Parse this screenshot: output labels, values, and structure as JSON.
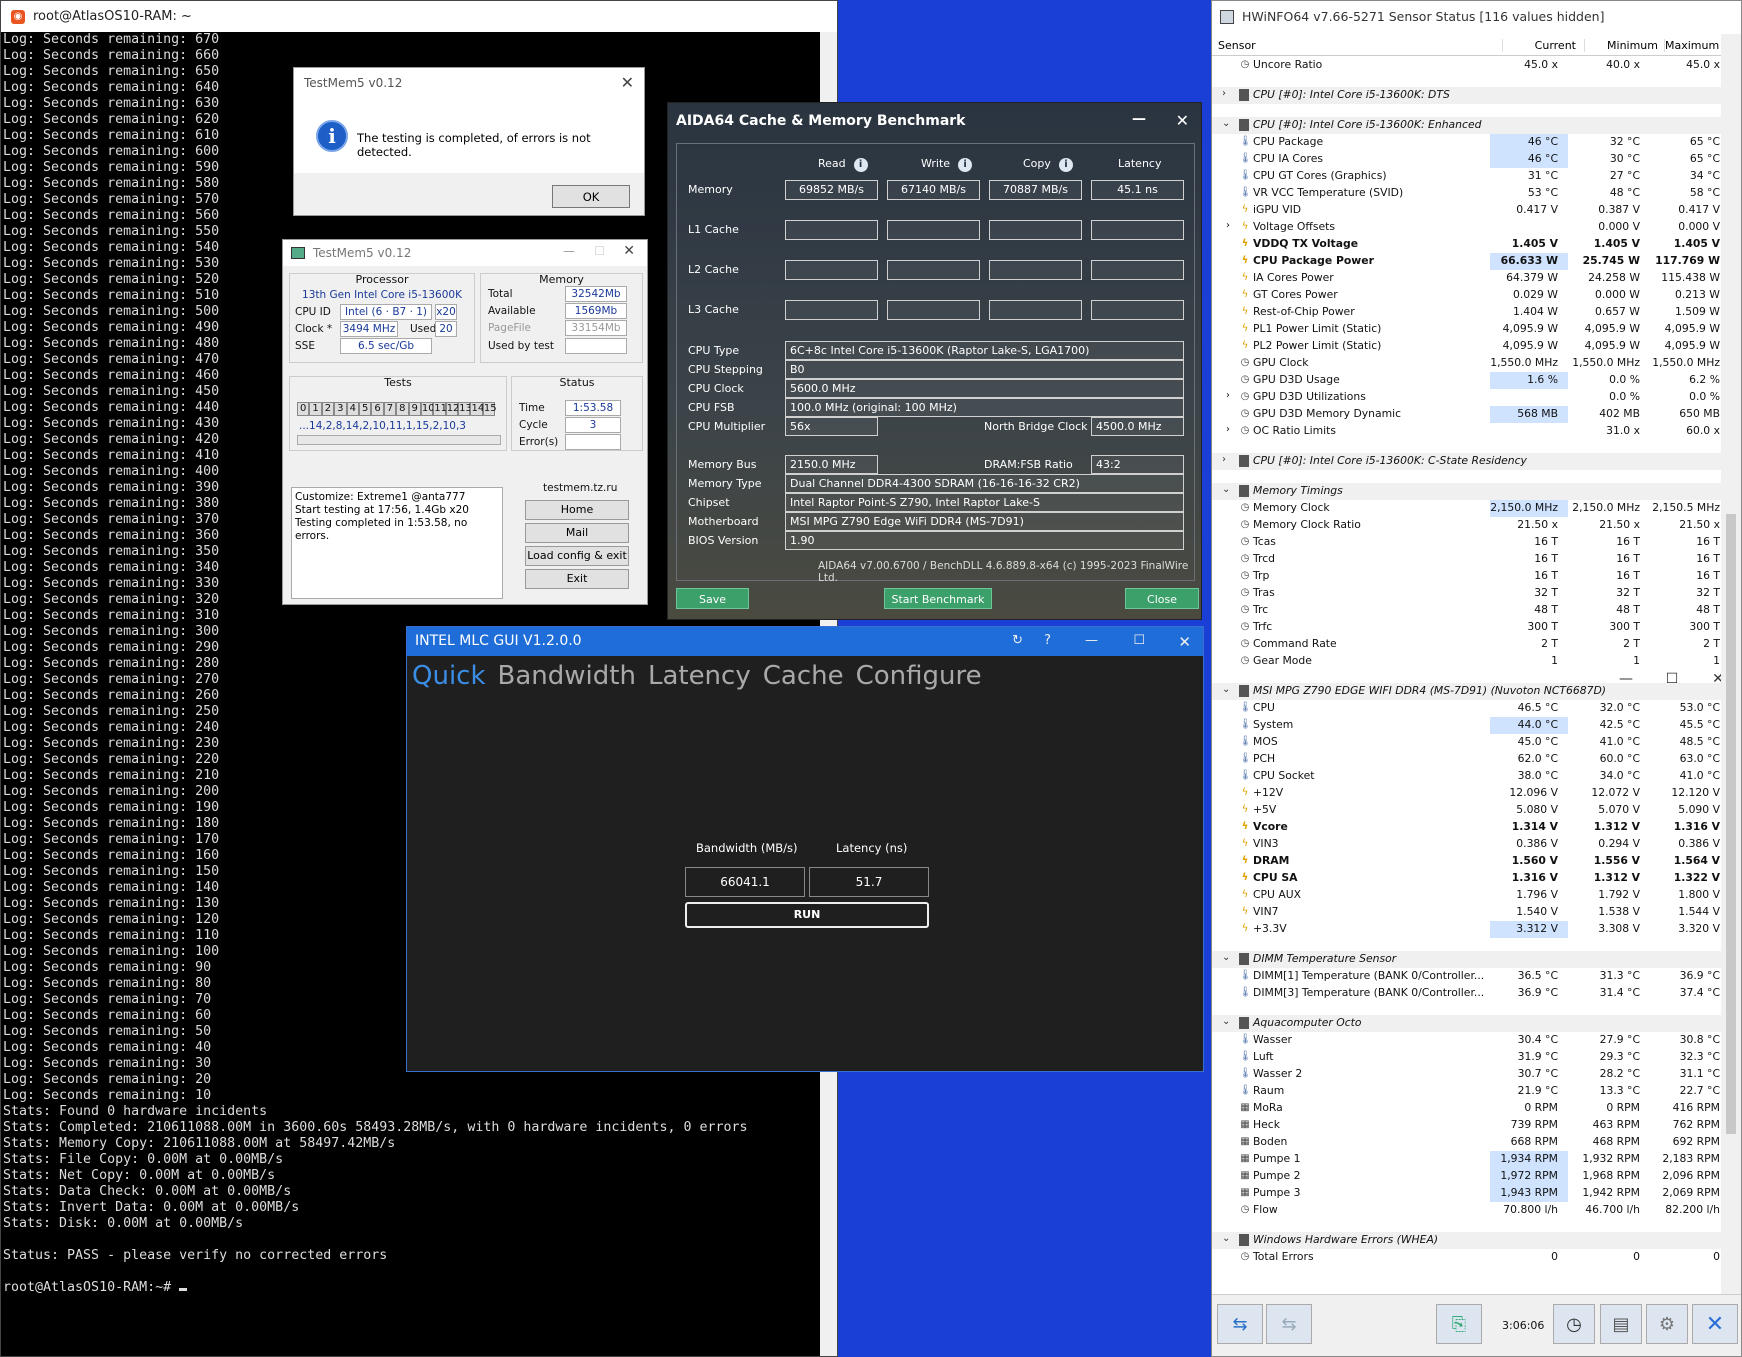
{
  "terminal": {
    "title": "root@AtlasOS10-RAM: ~",
    "log_lines": [
      "Log: Seconds remaining: 670",
      "Log: Seconds remaining: 660",
      "Log: Seconds remaining: 650",
      "Log: Seconds remaining: 640",
      "Log: Seconds remaining: 630",
      "Log: Seconds remaining: 620",
      "Log: Seconds remaining: 610",
      "Log: Seconds remaining: 600",
      "Log: Seconds remaining: 590",
      "Log: Seconds remaining: 580",
      "Log: Seconds remaining: 570",
      "Log: Seconds remaining: 560",
      "Log: Seconds remaining: 550",
      "Log: Seconds remaining: 540",
      "Log: Seconds remaining: 530",
      "Log: Seconds remaining: 520",
      "Log: Seconds remaining: 510",
      "Log: Seconds remaining: 500",
      "Log: Seconds remaining: 490",
      "Log: Seconds remaining: 480",
      "Log: Seconds remaining: 470",
      "Log: Seconds remaining: 460",
      "Log: Seconds remaining: 450",
      "Log: Seconds remaining: 440",
      "Log: Seconds remaining: 430",
      "Log: Seconds remaining: 420",
      "Log: Seconds remaining: 410",
      "Log: Seconds remaining: 400",
      "Log: Seconds remaining: 390",
      "Log: Seconds remaining: 380",
      "Log: Seconds remaining: 370",
      "Log: Seconds remaining: 360",
      "Log: Seconds remaining: 350",
      "Log: Seconds remaining: 340",
      "Log: Seconds remaining: 330",
      "Log: Seconds remaining: 320",
      "Log: Seconds remaining: 310",
      "Log: Seconds remaining: 300",
      "Log: Seconds remaining: 290",
      "Log: Seconds remaining: 280",
      "Log: Seconds remaining: 270",
      "Log: Seconds remaining: 260",
      "Log: Seconds remaining: 250",
      "Log: Seconds remaining: 240",
      "Log: Seconds remaining: 230",
      "Log: Seconds remaining: 220",
      "Log: Seconds remaining: 210",
      "Log: Seconds remaining: 200",
      "Log: Seconds remaining: 190",
      "Log: Seconds remaining: 180",
      "Log: Seconds remaining: 170",
      "Log: Seconds remaining: 160",
      "Log: Seconds remaining: 150",
      "Log: Seconds remaining: 140",
      "Log: Seconds remaining: 130",
      "Log: Seconds remaining: 120",
      "Log: Seconds remaining: 110",
      "Log: Seconds remaining: 100",
      "Log: Seconds remaining: 90",
      "Log: Seconds remaining: 80",
      "Log: Seconds remaining: 70",
      "Log: Seconds remaining: 60",
      "Log: Seconds remaining: 50",
      "Log: Seconds remaining: 40",
      "Log: Seconds remaining: 30",
      "Log: Seconds remaining: 20",
      "Log: Seconds remaining: 10",
      "Stats: Found 0 hardware incidents",
      "Stats: Completed: 210611088.00M in 3600.60s 58493.28MB/s, with 0 hardware incidents, 0 errors",
      "Stats: Memory Copy: 210611088.00M at 58497.42MB/s",
      "Stats: File Copy: 0.00M at 0.00MB/s",
      "Stats: Net Copy: 0.00M at 0.00MB/s",
      "Stats: Data Check: 0.00M at 0.00MB/s",
      "Stats: Invert Data: 0.00M at 0.00MB/s",
      "Stats: Disk: 0.00M at 0.00MB/s",
      "",
      "Status: PASS - please verify no corrected errors",
      ""
    ],
    "prompt": "root@AtlasOS10-RAM:~# "
  },
  "tm_dialog": {
    "title": "TestMem5 v0.12",
    "message": "The testing is completed, of errors is not detected.",
    "ok": "OK"
  },
  "testmem": {
    "title": "TestMem5 v0.12",
    "processor_label": "Processor",
    "processor_name": "13th Gen Intel Core i5-13600K",
    "cpuid_label": "CPU ID",
    "cpuid": "Intel (6 · B7 · 1)",
    "threads": "x20",
    "clock_label": "Clock *",
    "clock": "3494 MHz",
    "used_label": "Used",
    "used": "20",
    "sse_label": "SSE",
    "sse": "6.5 sec/Gb",
    "memory_label": "Memory",
    "total_label": "Total",
    "total": "32542Mb",
    "available_label": "Available",
    "available": "1569Mb",
    "pagefile_label": "PageFile",
    "pagefile": "33154Mb",
    "usedbytest_label": "Used by test",
    "usedbytest": "",
    "tests_label": "Tests",
    "test_cells": [
      "0",
      "1",
      "2",
      "3",
      "4",
      "5",
      "6",
      "7",
      "8",
      "9",
      "10",
      "11",
      "12",
      "13",
      "14",
      "15"
    ],
    "test_sequence": "...14,2,8,14,2,10,11,1,15,2,10,3",
    "status_label": "Status",
    "time_label": "Time",
    "time": "1:53.58",
    "cycle_label": "Cycle",
    "cycle": "3",
    "errors_label": "Error(s)",
    "errors": "",
    "log": [
      "Customize: Extreme1 @anta777",
      "Start testing at 17:56, 1.4Gb x20",
      "Testing completed in 1:53.58, no errors."
    ],
    "site": "testmem.tz.ru",
    "btn_home": "Home",
    "btn_mail": "Mail",
    "btn_load": "Load config & exit",
    "btn_exit": "Exit"
  },
  "aida": {
    "title": "AIDA64 Cache & Memory Benchmark",
    "col_read": "Read",
    "col_write": "Write",
    "col_copy": "Copy",
    "col_latency": "Latency",
    "row_memory": "Memory",
    "row_l1": "L1 Cache",
    "row_l2": "L2 Cache",
    "row_l3": "L3 Cache",
    "mem_read": "69852 MB/s",
    "mem_write": "67140 MB/s",
    "mem_copy": "70887 MB/s",
    "mem_latency": "45.1 ns",
    "cpu_type_label": "CPU Type",
    "cpu_type": "6C+8c Intel Core i5-13600K (Raptor Lake-S, LGA1700)",
    "cpu_stepping_label": "CPU Stepping",
    "cpu_stepping": "B0",
    "cpu_clock_label": "CPU Clock",
    "cpu_clock": "5600.0 MHz",
    "cpu_fsb_label": "CPU FSB",
    "cpu_fsb": "100.0 MHz (original: 100 MHz)",
    "cpu_mult_label": "CPU Multiplier",
    "cpu_mult": "56x",
    "nb_clock_label": "North Bridge Clock",
    "nb_clock": "4500.0 MHz",
    "mem_bus_label": "Memory Bus",
    "mem_bus": "2150.0 MHz",
    "dram_fsb_label": "DRAM:FSB Ratio",
    "dram_fsb": "43:2",
    "mem_type_label": "Memory Type",
    "mem_type": "Dual Channel DDR4-4300 SDRAM (16-16-16-32 CR2)",
    "chipset_label": "Chipset",
    "chipset": "Intel Raptor Point-S Z790, Intel Raptor Lake-S",
    "mobo_label": "Motherboard",
    "mobo": "MSI MPG Z790 Edge WiFi DDR4 (MS-7D91)",
    "bios_label": "BIOS Version",
    "bios": "1.90",
    "footer": "AIDA64 v7.00.6700 / BenchDLL 4.6.889.8-x64 (c) 1995-2023 FinalWire Ltd.",
    "btn_save": "Save",
    "btn_start": "Start Benchmark",
    "btn_close": "Close"
  },
  "mlc": {
    "title": "INTEL MLC GUI V1.2.0.0",
    "tabs": [
      "Quick",
      "Bandwidth",
      "Latency",
      "Cache",
      "Configure"
    ],
    "bw_label": "Bandwidth (MB/s)",
    "lat_label": "Latency (ns)",
    "bw_value": "66041.1",
    "lat_value": "51.7",
    "run": "RUN"
  },
  "hwinfo": {
    "title": "HWiNFO64 v7.66-5271 Sensor Status [116 values hidden]",
    "col_sensor": "Sensor",
    "col_current": "Current",
    "col_min": "Minimum",
    "col_max": "Maximum",
    "time": "3:06:06",
    "rows": [
      {
        "t": "r",
        "icon": "o",
        "n": "Uncore Ratio",
        "c": "45.0 x",
        "mi": "40.0 x",
        "ma": "45.0 x"
      },
      {
        "t": "s"
      },
      {
        "t": "g",
        "exp": ">",
        "n": "CPU [#0]: Intel Core i5-13600K: DTS"
      },
      {
        "t": "s"
      },
      {
        "t": "g",
        "exp": "v",
        "n": "CPU [#0]: Intel Core i5-13600K: Enhanced"
      },
      {
        "t": "r",
        "icon": "t",
        "n": "CPU Package",
        "c": "46 °C",
        "mi": "32 °C",
        "ma": "65 °C",
        "hl": true
      },
      {
        "t": "r",
        "icon": "t",
        "n": "CPU IA Cores",
        "c": "46 °C",
        "mi": "30 °C",
        "ma": "65 °C",
        "hl": true
      },
      {
        "t": "r",
        "icon": "t",
        "n": "CPU GT Cores (Graphics)",
        "c": "31 °C",
        "mi": "27 °C",
        "ma": "34 °C"
      },
      {
        "t": "r",
        "icon": "t",
        "n": "VR VCC Temperature (SVID)",
        "c": "53 °C",
        "mi": "48 °C",
        "ma": "58 °C"
      },
      {
        "t": "r",
        "icon": "v",
        "n": "iGPU VID",
        "c": "0.417 V",
        "mi": "0.387 V",
        "ma": "0.417 V"
      },
      {
        "t": "r",
        "icon": "v",
        "exp": ">",
        "n": "Voltage Offsets",
        "c": "",
        "mi": "0.000 V",
        "ma": "0.000 V"
      },
      {
        "t": "r",
        "icon": "v",
        "n": "VDDQ TX Voltage",
        "c": "1.405 V",
        "mi": "1.405 V",
        "ma": "1.405 V",
        "b": true
      },
      {
        "t": "r",
        "icon": "v",
        "n": "CPU Package Power",
        "c": "66.633 W",
        "mi": "25.745 W",
        "ma": "117.769 W",
        "b": true,
        "hl": true
      },
      {
        "t": "r",
        "icon": "v",
        "n": "IA Cores Power",
        "c": "64.379 W",
        "mi": "24.258 W",
        "ma": "115.438 W"
      },
      {
        "t": "r",
        "icon": "v",
        "n": "GT Cores Power",
        "c": "0.029 W",
        "mi": "0.000 W",
        "ma": "0.213 W"
      },
      {
        "t": "r",
        "icon": "v",
        "n": "Rest-of-Chip Power",
        "c": "1.404 W",
        "mi": "0.657 W",
        "ma": "1.509 W"
      },
      {
        "t": "r",
        "icon": "v",
        "n": "PL1 Power Limit (Static)",
        "c": "4,095.9 W",
        "mi": "4,095.9 W",
        "ma": "4,095.9 W"
      },
      {
        "t": "r",
        "icon": "v",
        "n": "PL2 Power Limit (Static)",
        "c": "4,095.9 W",
        "mi": "4,095.9 W",
        "ma": "4,095.9 W"
      },
      {
        "t": "r",
        "icon": "o",
        "n": "GPU Clock",
        "c": "1,550.0 MHz",
        "mi": "1,550.0 MHz",
        "ma": "1,550.0 MHz"
      },
      {
        "t": "r",
        "icon": "o",
        "n": "GPU D3D Usage",
        "c": "1.6 %",
        "mi": "0.0 %",
        "ma": "6.2 %",
        "hl": true
      },
      {
        "t": "r",
        "icon": "o",
        "exp": ">",
        "n": "GPU D3D Utilizations",
        "c": "",
        "mi": "0.0 %",
        "ma": "0.0 %"
      },
      {
        "t": "r",
        "icon": "o",
        "n": "GPU D3D Memory Dynamic",
        "c": "568 MB",
        "mi": "402 MB",
        "ma": "650 MB",
        "hl": true
      },
      {
        "t": "r",
        "icon": "o",
        "exp": ">",
        "n": "OC Ratio Limits",
        "c": "",
        "mi": "31.0 x",
        "ma": "60.0 x"
      },
      {
        "t": "s"
      },
      {
        "t": "g",
        "exp": ">",
        "n": "CPU [#0]: Intel Core i5-13600K: C-State Residency"
      },
      {
        "t": "s"
      },
      {
        "t": "g",
        "exp": "v",
        "n": "Memory Timings"
      },
      {
        "t": "r",
        "icon": "o",
        "n": "Memory Clock",
        "c": "2,150.0 MHz",
        "mi": "2,150.0 MHz",
        "ma": "2,150.5 MHz",
        "hl": true
      },
      {
        "t": "r",
        "icon": "o",
        "n": "Memory Clock Ratio",
        "c": "21.50 x",
        "mi": "21.50 x",
        "ma": "21.50 x"
      },
      {
        "t": "r",
        "icon": "o",
        "n": "Tcas",
        "c": "16 T",
        "mi": "16 T",
        "ma": "16 T"
      },
      {
        "t": "r",
        "icon": "o",
        "n": "Trcd",
        "c": "16 T",
        "mi": "16 T",
        "ma": "16 T"
      },
      {
        "t": "r",
        "icon": "o",
        "n": "Trp",
        "c": "16 T",
        "mi": "16 T",
        "ma": "16 T"
      },
      {
        "t": "r",
        "icon": "o",
        "n": "Tras",
        "c": "32 T",
        "mi": "32 T",
        "ma": "32 T"
      },
      {
        "t": "r",
        "icon": "o",
        "n": "Trc",
        "c": "48 T",
        "mi": "48 T",
        "ma": "48 T"
      },
      {
        "t": "r",
        "icon": "o",
        "n": "Trfc",
        "c": "300 T",
        "mi": "300 T",
        "ma": "300 T"
      },
      {
        "t": "r",
        "icon": "o",
        "n": "Command Rate",
        "c": "2 T",
        "mi": "2 T",
        "ma": "2 T"
      },
      {
        "t": "r",
        "icon": "o",
        "n": "Gear Mode",
        "c": "1",
        "mi": "1",
        "ma": "1"
      },
      {
        "t": "s"
      },
      {
        "t": "g",
        "exp": "v",
        "n": "MSI MPG Z790 EDGE WIFI DDR4 (MS-7D91) (Nuvoton NCT6687D)"
      },
      {
        "t": "r",
        "icon": "t",
        "n": "CPU",
        "c": "46.5 °C",
        "mi": "32.0 °C",
        "ma": "53.0 °C"
      },
      {
        "t": "r",
        "icon": "t",
        "n": "System",
        "c": "44.0 °C",
        "mi": "42.5 °C",
        "ma": "45.5 °C",
        "hl": true
      },
      {
        "t": "r",
        "icon": "t",
        "n": "MOS",
        "c": "45.0 °C",
        "mi": "41.0 °C",
        "ma": "48.5 °C"
      },
      {
        "t": "r",
        "icon": "t",
        "n": "PCH",
        "c": "62.0 °C",
        "mi": "60.0 °C",
        "ma": "63.0 °C"
      },
      {
        "t": "r",
        "icon": "t",
        "n": "CPU Socket",
        "c": "38.0 °C",
        "mi": "34.0 °C",
        "ma": "41.0 °C"
      },
      {
        "t": "r",
        "icon": "v",
        "n": "+12V",
        "c": "12.096 V",
        "mi": "12.072 V",
        "ma": "12.120 V"
      },
      {
        "t": "r",
        "icon": "v",
        "n": "+5V",
        "c": "5.080 V",
        "mi": "5.070 V",
        "ma": "5.090 V"
      },
      {
        "t": "r",
        "icon": "v",
        "n": "Vcore",
        "c": "1.314 V",
        "mi": "1.312 V",
        "ma": "1.316 V",
        "b": true
      },
      {
        "t": "r",
        "icon": "v",
        "n": "VIN3",
        "c": "0.386 V",
        "mi": "0.294 V",
        "ma": "0.386 V"
      },
      {
        "t": "r",
        "icon": "v",
        "n": "DRAM",
        "c": "1.560 V",
        "mi": "1.556 V",
        "ma": "1.564 V",
        "b": true
      },
      {
        "t": "r",
        "icon": "v",
        "n": "CPU SA",
        "c": "1.316 V",
        "mi": "1.312 V",
        "ma": "1.322 V",
        "b": true
      },
      {
        "t": "r",
        "icon": "v",
        "n": "CPU AUX",
        "c": "1.796 V",
        "mi": "1.792 V",
        "ma": "1.800 V"
      },
      {
        "t": "r",
        "icon": "v",
        "n": "VIN7",
        "c": "1.540 V",
        "mi": "1.538 V",
        "ma": "1.544 V"
      },
      {
        "t": "r",
        "icon": "v",
        "n": "+3.3V",
        "c": "3.312 V",
        "mi": "3.308 V",
        "ma": "3.320 V",
        "hl": true
      },
      {
        "t": "s"
      },
      {
        "t": "g",
        "exp": "v",
        "n": "DIMM Temperature Sensor"
      },
      {
        "t": "r",
        "icon": "t",
        "n": "DIMM[1] Temperature (BANK 0/Controller...",
        "c": "36.5 °C",
        "mi": "31.3 °C",
        "ma": "36.9 °C"
      },
      {
        "t": "r",
        "icon": "t",
        "n": "DIMM[3] Temperature (BANK 0/Controller...",
        "c": "36.9 °C",
        "mi": "31.4 °C",
        "ma": "37.4 °C"
      },
      {
        "t": "s"
      },
      {
        "t": "g",
        "exp": "v",
        "n": "Aquacomputer Octo"
      },
      {
        "t": "r",
        "icon": "t",
        "n": "Wasser",
        "c": "30.4 °C",
        "mi": "27.9 °C",
        "ma": "30.8 °C"
      },
      {
        "t": "r",
        "icon": "t",
        "n": "Luft",
        "c": "31.9 °C",
        "mi": "29.3 °C",
        "ma": "32.3 °C"
      },
      {
        "t": "r",
        "icon": "t",
        "n": "Wasser 2",
        "c": "30.7 °C",
        "mi": "28.2 °C",
        "ma": "31.1 °C"
      },
      {
        "t": "r",
        "icon": "t",
        "n": "Raum",
        "c": "21.9 °C",
        "mi": "13.3 °C",
        "ma": "22.7 °C"
      },
      {
        "t": "r",
        "icon": "f",
        "n": "MoRa",
        "c": "0 RPM",
        "mi": "0 RPM",
        "ma": "416 RPM"
      },
      {
        "t": "r",
        "icon": "f",
        "n": "Heck",
        "c": "739 RPM",
        "mi": "463 RPM",
        "ma": "762 RPM"
      },
      {
        "t": "r",
        "icon": "f",
        "n": "Boden",
        "c": "668 RPM",
        "mi": "468 RPM",
        "ma": "692 RPM"
      },
      {
        "t": "r",
        "icon": "f",
        "n": "Pumpe 1",
        "c": "1,934 RPM",
        "mi": "1,932 RPM",
        "ma": "2,183 RPM",
        "hl": true
      },
      {
        "t": "r",
        "icon": "f",
        "n": "Pumpe 2",
        "c": "1,972 RPM",
        "mi": "1,968 RPM",
        "ma": "2,096 RPM",
        "hl": true
      },
      {
        "t": "r",
        "icon": "f",
        "n": "Pumpe 3",
        "c": "1,943 RPM",
        "mi": "1,942 RPM",
        "ma": "2,069 RPM",
        "hl": true
      },
      {
        "t": "r",
        "icon": "o",
        "n": "Flow",
        "c": "70.800 l/h",
        "mi": "46.700 l/h",
        "ma": "82.200 l/h"
      },
      {
        "t": "s"
      },
      {
        "t": "g",
        "exp": "v",
        "n": "Windows Hardware Errors (WHEA)"
      },
      {
        "t": "r",
        "icon": "o",
        "n": "Total Errors",
        "c": "0",
        "mi": "0",
        "ma": "0"
      }
    ]
  }
}
